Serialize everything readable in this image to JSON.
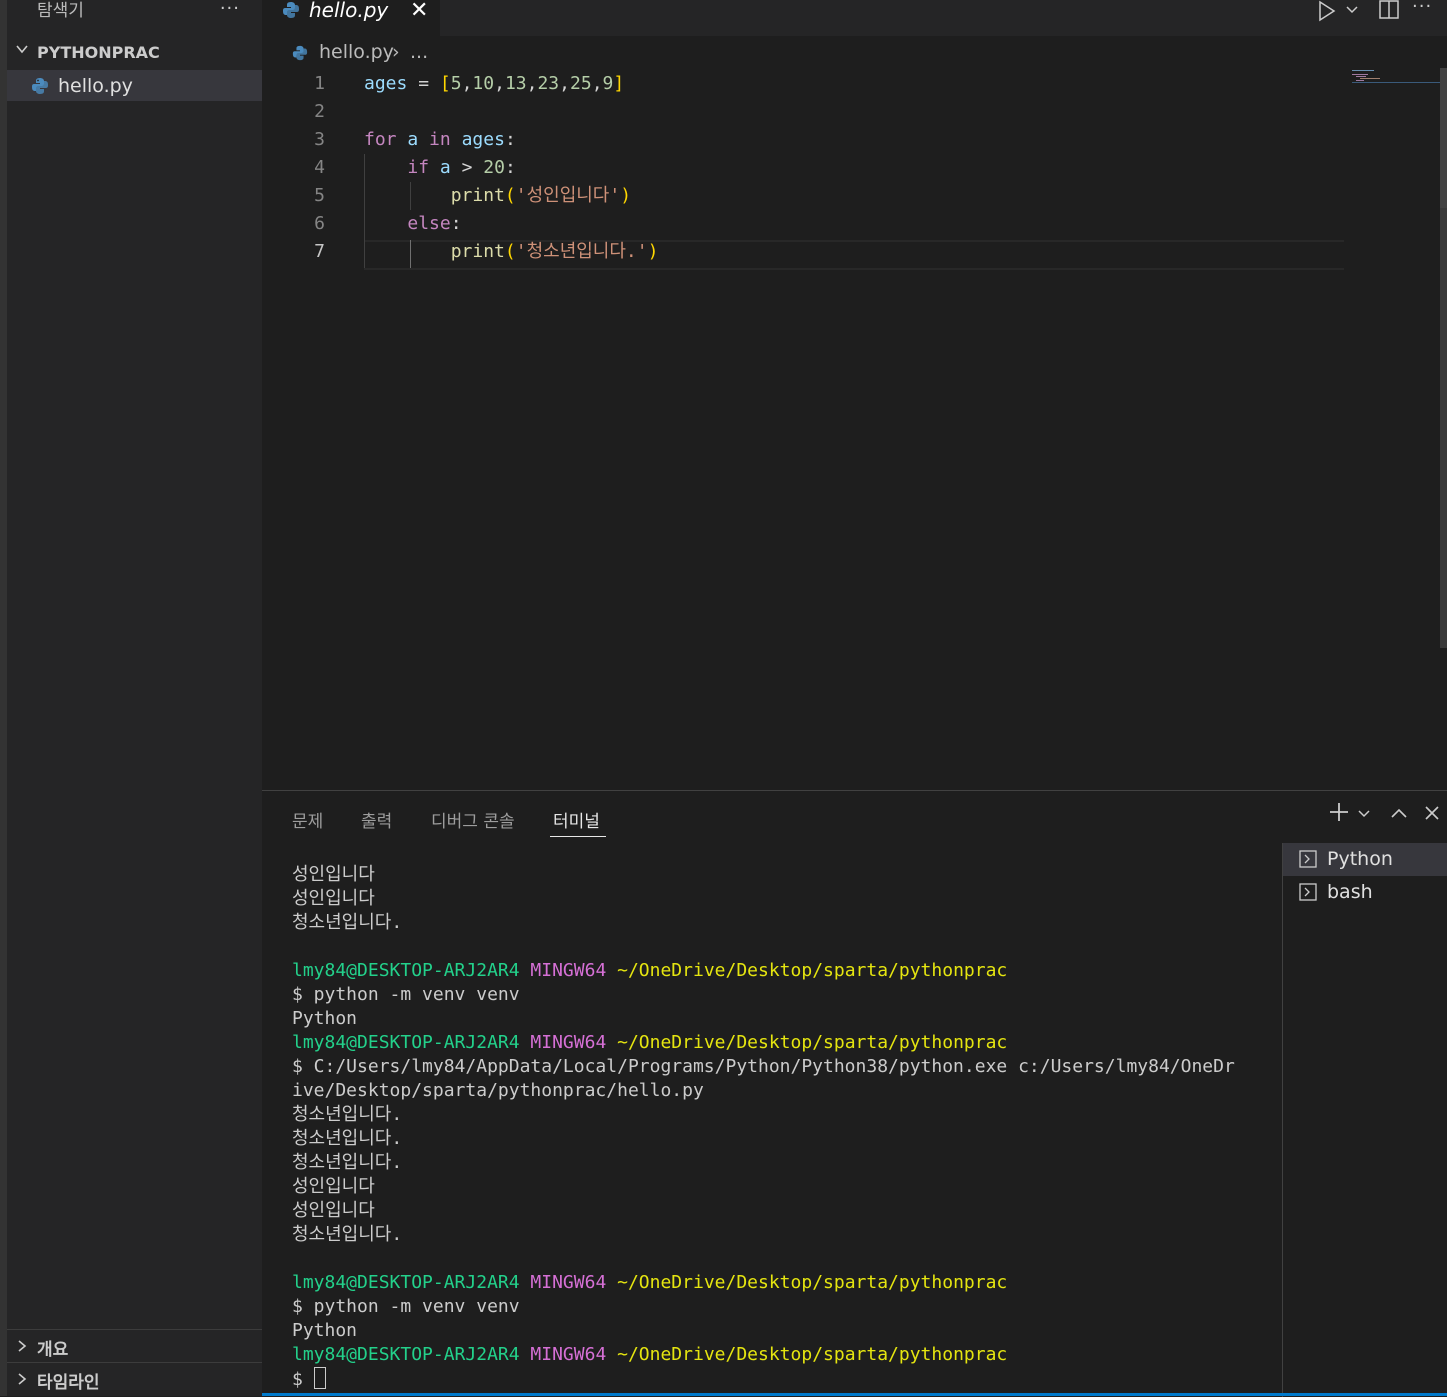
{
  "sidebar": {
    "title": "탐색기",
    "more": "···",
    "folder": "PYTHONPRAC",
    "files": [
      "hello.py"
    ],
    "outline": "개요",
    "timeline": "타임라인"
  },
  "editor": {
    "tab": {
      "label": "hello.py",
      "close": "✕"
    },
    "more": "···",
    "breadcrumb": {
      "file": "hello.py",
      "sep": "›",
      "rest": "..."
    },
    "line_numbers": [
      "1",
      "2",
      "3",
      "4",
      "5",
      "6",
      "7"
    ]
  },
  "panel": {
    "tabs": [
      "문제",
      "출력",
      "디버그 콘솔",
      "터미널"
    ],
    "active_tab": "터미널",
    "terminals": [
      "Python",
      "bash"
    ]
  },
  "terminal_text": {
    "out1": "성인입니다",
    "out2": "성인입니다",
    "out3": "청소년입니다.",
    "user": "lmy84@DESKTOP-ARJ2AR4",
    "env": "MINGW64",
    "path": "~/OneDrive/Desktop/sparta/pythonprac",
    "cmd_venv": "$ python -m venv venv",
    "python": "Python",
    "cmd_run1": "$ C:/Users/lmy84/AppData/Local/Programs/Python/Python38/python.exe c:/Users/lmy84/OneDr",
    "cmd_run2": "ive/Desktop/sparta/pythonprac/hello.py",
    "run_out": [
      "청소년입니다.",
      "청소년입니다.",
      "청소년입니다.",
      "성인입니다",
      "성인입니다",
      "청소년입니다."
    ],
    "prompt": "$ "
  },
  "colors": {
    "accent": "#007acc",
    "terminal_green": "#23d18b",
    "terminal_magenta": "#d670d6",
    "terminal_yellow": "#e5e510"
  }
}
